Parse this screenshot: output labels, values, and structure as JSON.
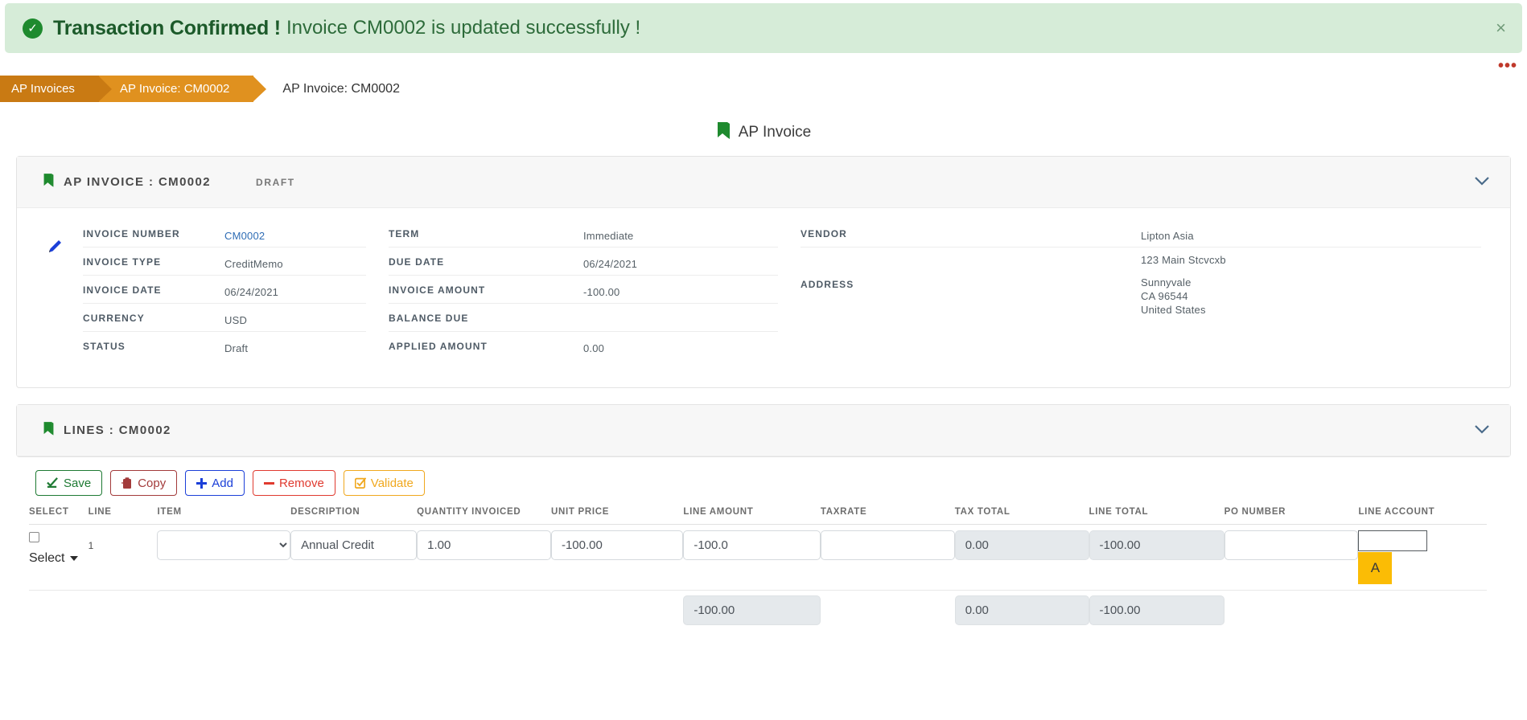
{
  "alert": {
    "icon": "check-circle-icon",
    "strong": "Transaction Confirmed !",
    "message": "Invoice CM0002 is updated successfully !",
    "close_label": "×",
    "bg_color": "#d6ecd8",
    "accent_color": "#1e8a2e"
  },
  "kebab": {
    "label": "•••",
    "color": "#c0392b"
  },
  "breadcrumb": {
    "items": [
      {
        "label": "AP Invoices",
        "style": "dark"
      },
      {
        "label": "AP Invoice: CM0002",
        "style": "light"
      },
      {
        "label": "AP Invoice: CM0002",
        "style": "plain"
      }
    ],
    "colors": {
      "dark": "#c97a13",
      "light": "#e0911f"
    }
  },
  "page_title": {
    "icon": "bookmark-icon",
    "label": "AP Invoice"
  },
  "invoice_card": {
    "icon": "bookmark-icon",
    "title": "AP INVOICE : CM0002",
    "status": "DRAFT",
    "collapse_icon": "chevron-down-icon",
    "edit_icon": "pencil-icon",
    "col1": [
      {
        "label": "INVOICE NUMBER",
        "value": "CM0002",
        "link": true
      },
      {
        "label": "INVOICE TYPE",
        "value": "CreditMemo"
      },
      {
        "label": "INVOICE DATE",
        "value": "06/24/2021"
      },
      {
        "label": "CURRENCY",
        "value": "USD"
      },
      {
        "label": "STATUS",
        "value": "Draft"
      }
    ],
    "col2": [
      {
        "label": "TERM",
        "value": "Immediate"
      },
      {
        "label": "DUE DATE",
        "value": "06/24/2021"
      },
      {
        "label": "INVOICE AMOUNT",
        "value": "-100.00"
      },
      {
        "label": "BALANCE DUE",
        "value": ""
      },
      {
        "label": "APPLIED AMOUNT",
        "value": "0.00"
      }
    ],
    "vendor_label": "VENDOR",
    "vendor_value": "Lipton Asia",
    "address_label": "ADDRESS",
    "address_street": "123 Main Stcvcxb",
    "address_city": "Sunnyvale",
    "address_state_zip": "CA 96544",
    "address_country": "United States"
  },
  "lines_card": {
    "icon": "bookmark-icon",
    "title": "LINES : CM0002",
    "collapse_icon": "chevron-down-icon"
  },
  "toolbar": {
    "save_label": "Save",
    "copy_label": "Copy",
    "add_label": "Add",
    "remove_label": "Remove",
    "validate_label": "Validate",
    "save_color": "#1e7a33",
    "copy_color": "#a33b3b",
    "add_color": "#1b3fd8",
    "remove_color": "#e03a2f",
    "validate_color": "#f0a81e"
  },
  "lines_table": {
    "headers": [
      "SELECT",
      "LINE",
      "ITEM",
      "DESCRIPTION",
      "QUANTITY INVOICED",
      "UNIT PRICE",
      "LINE AMOUNT",
      "TAXRATE",
      "TAX TOTAL",
      "LINE TOTAL",
      "PO NUMBER",
      "LINE ACCOUNT"
    ],
    "row": {
      "select_label": "Select",
      "line": "1",
      "item": "",
      "item_placeholder": "",
      "description": "Annual Credit",
      "quantity_invoiced": "1.00",
      "unit_price": "-100.00",
      "line_amount": "-100.0",
      "taxrate": "",
      "tax_total": "0.00",
      "line_total": "-100.00",
      "po_number": "",
      "line_account": "",
      "account_badge": "A"
    },
    "totals": {
      "line_amount": "-100.00",
      "tax_total": "0.00",
      "line_total": "-100.00"
    }
  }
}
